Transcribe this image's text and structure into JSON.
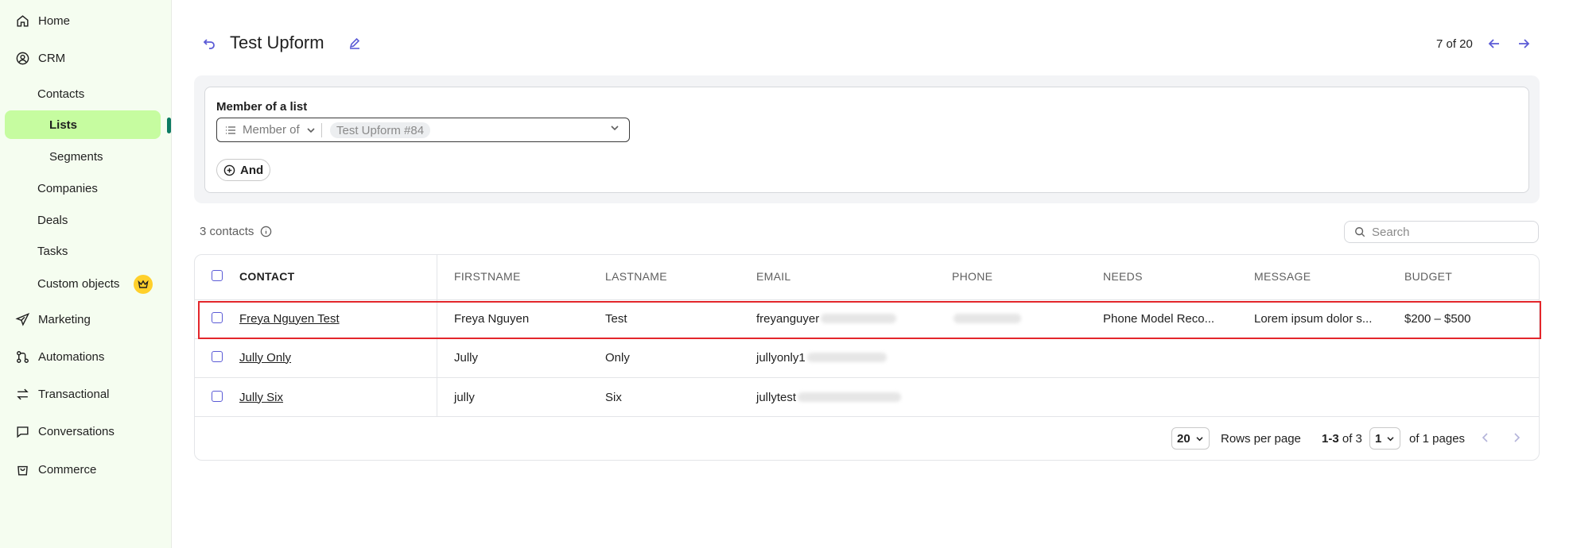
{
  "sidebar": {
    "home": "Home",
    "crm": "CRM",
    "contacts": "Contacts",
    "lists": "Lists",
    "segments": "Segments",
    "companies": "Companies",
    "deals": "Deals",
    "tasks": "Tasks",
    "custom_objects": "Custom objects",
    "marketing": "Marketing",
    "automations": "Automations",
    "transactional": "Transactional",
    "conversations": "Conversations",
    "commerce": "Commerce"
  },
  "header": {
    "title": "Test Upform",
    "pager": "7 of 20"
  },
  "filter": {
    "group_label": "Member of a list",
    "operator": "Member of",
    "value_chip": "Test Upform #84",
    "and_label": "And"
  },
  "contacts_count": "3 contacts",
  "search": {
    "placeholder": "Search"
  },
  "table": {
    "columns": [
      "CONTACT",
      "FIRSTNAME",
      "LASTNAME",
      "EMAIL",
      "PHONE",
      "NEEDS",
      "MESSAGE",
      "BUDGET"
    ],
    "rows": [
      {
        "contact": "Freya Nguyen Test",
        "firstname": "Freya Nguyen",
        "lastname": "Test",
        "email": "freyanguyer",
        "phone": "",
        "needs": "Phone Model Reco...",
        "message": "Lorem ipsum dolor s...",
        "budget": "$200 – $500"
      },
      {
        "contact": "Jully Only",
        "firstname": "Jully",
        "lastname": "Only",
        "email": "jullyonly1",
        "phone": "",
        "needs": "",
        "message": "",
        "budget": ""
      },
      {
        "contact": "Jully Six",
        "firstname": "jully",
        "lastname": "Six",
        "email": "jullytest",
        "phone": "",
        "needs": "",
        "message": "",
        "budget": ""
      }
    ]
  },
  "pagination": {
    "rows_per_page_value": "20",
    "rows_per_page_label": "Rows per page",
    "range_bold": "1-3",
    "range_rest": "of 3",
    "page_value": "1",
    "pages_label": "of 1 pages"
  },
  "colors": {
    "sidebar_bg": "#f5fdf0",
    "active_item_bg": "#c6fca0",
    "active_indicator": "#0b7a62",
    "accent": "#5b5bd6",
    "highlight_border": "#e3262b",
    "crown_badge": "#ffd02b"
  },
  "icons": {
    "home": "home-icon",
    "crm": "user-circle-icon",
    "marketing": "paper-plane-icon",
    "automations": "automation-icon",
    "transactional": "arrows-swap-icon",
    "conversations": "chat-icon",
    "commerce": "shopping-bag-icon",
    "custom_objects_badge": "crown-icon"
  }
}
